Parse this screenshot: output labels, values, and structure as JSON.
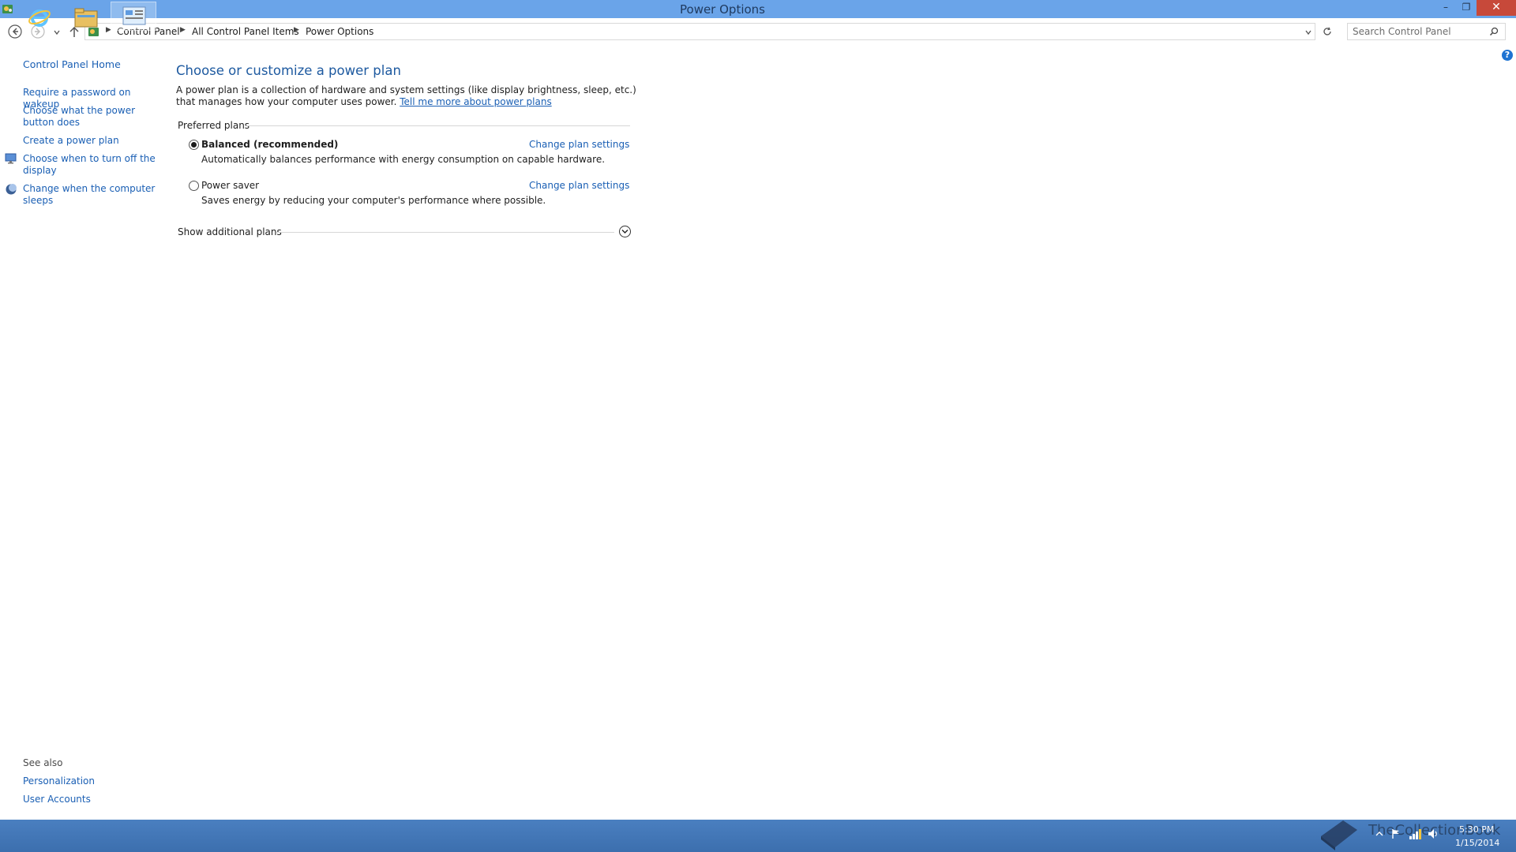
{
  "window": {
    "title": "Power Options",
    "minimize_glyph": "–",
    "maximize_glyph": "❐",
    "close_glyph": "✕"
  },
  "addressbar": {
    "crumbs": [
      "Control Panel",
      "All Control Panel Items",
      "Power Options"
    ],
    "search_placeholder": "Search Control Panel"
  },
  "sidebar": {
    "home": "Control Panel Home",
    "links": [
      "Require a password on wakeup",
      "Choose what the power button does",
      "Create a power plan",
      "Choose when to turn off the display",
      "Change when the computer sleeps"
    ],
    "see_also_label": "See also",
    "see_also": [
      "Personalization",
      "User Accounts"
    ]
  },
  "main": {
    "heading": "Choose or customize a power plan",
    "intro": "A power plan is a collection of hardware and system settings (like display brightness, sleep, etc.) that manages how your computer uses power.",
    "intro_link": "Tell me more about power plans",
    "preferred_label": "Preferred plans",
    "plans": [
      {
        "name": "Balanced (recommended)",
        "description": "Automatically balances performance with energy consumption on capable hardware.",
        "link": "Change plan settings",
        "selected": true
      },
      {
        "name": "Power saver",
        "description": "Saves energy by reducing your computer's performance where possible.",
        "link": "Change plan settings",
        "selected": false
      }
    ],
    "additional_label": "Show additional plans"
  },
  "taskbar": {
    "time": "5:30 PM",
    "date": "1/15/2014",
    "watermark": "TheCollectionBook"
  },
  "icons": {
    "help": "?",
    "search": "search-icon",
    "refresh": "refresh-icon"
  },
  "colors": {
    "titlebar": "#6aa4e9",
    "link": "#1a5fb4",
    "heading": "#1e5aa0",
    "taskbar": "#4277b8",
    "close": "#c7493a"
  }
}
